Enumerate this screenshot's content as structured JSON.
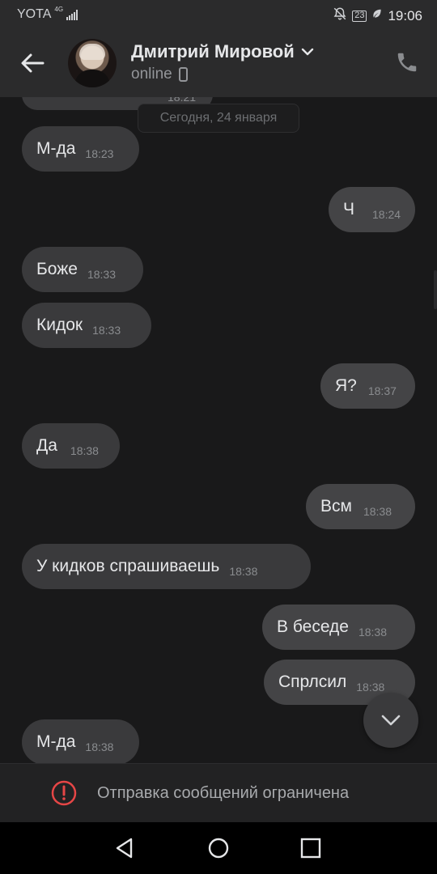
{
  "status_bar": {
    "carrier": "YOTA",
    "network": "4G",
    "battery": "23",
    "time": "19:06"
  },
  "header": {
    "contact_name": "Дмитрий Мировой",
    "status": "online"
  },
  "chat": {
    "partial_time": "18:21",
    "date_separator": "Сегодня, 24 января",
    "messages": [
      {
        "text": "М-да",
        "time": "18:23",
        "direction": "in"
      },
      {
        "text": "Ч",
        "time": "18:24",
        "direction": "out"
      },
      {
        "text": "Боже",
        "time": "18:33",
        "direction": "in"
      },
      {
        "text": "Кидок",
        "time": "18:33",
        "direction": "in"
      },
      {
        "text": "Я?",
        "time": "18:37",
        "direction": "out"
      },
      {
        "text": "Да",
        "time": "18:38",
        "direction": "in"
      },
      {
        "text": "Всм",
        "time": "18:38",
        "direction": "out"
      },
      {
        "text": "У кидков спрашиваешь",
        "time": "18:38",
        "direction": "in"
      },
      {
        "text": "В беседе",
        "time": "18:38",
        "direction": "out"
      },
      {
        "text": "Спрлсил",
        "time": "18:38",
        "direction": "out"
      },
      {
        "text": "М-да",
        "time": "18:38",
        "direction": "in"
      }
    ]
  },
  "footer": {
    "restricted_text": "Отправка сообщений ограничена"
  },
  "colors": {
    "background": "#19191a",
    "bar": "#2b2b2c",
    "bubble_in": "#3a3a3c",
    "bubble_out": "#444446",
    "alert_red": "#e64646"
  }
}
